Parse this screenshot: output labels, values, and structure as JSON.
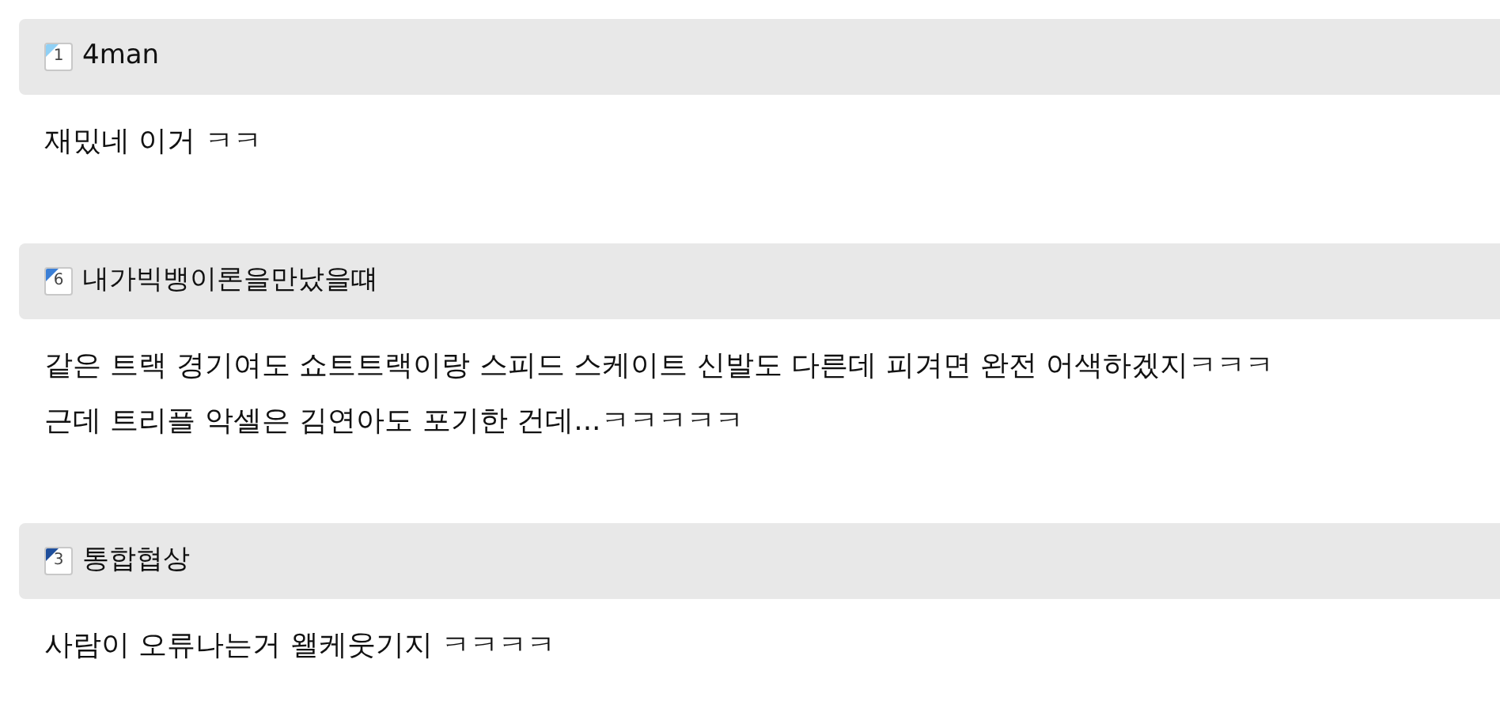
{
  "comments": [
    {
      "badge": "1",
      "color": "#8fd0f5",
      "author": "4man",
      "lines": [
        "재밌네 이거 ㅋㅋ"
      ]
    },
    {
      "badge": "6",
      "color": "#3b7fd6",
      "author": "내가빅뱅이론을만났을떄",
      "lines": [
        "같은 트랙 경기여도 쇼트트랙이랑 스피드 스케이트 신발도 다른데 피겨면 완전 어색하겠지ㅋㅋㅋ",
        "근데 트리플 악셀은 김연아도 포기한 건데...ㅋㅋㅋㅋㅋ"
      ]
    },
    {
      "badge": "3",
      "color": "#1f4f9c",
      "author": "통합협상",
      "lines": [
        "사람이 오류나는거 왤케웃기지 ㅋㅋㅋㅋ"
      ]
    }
  ]
}
